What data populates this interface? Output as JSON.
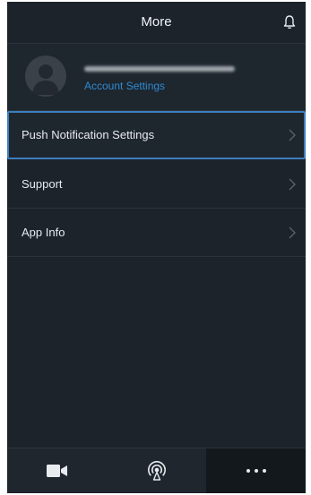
{
  "header": {
    "title": "More",
    "icon": "bell-icon"
  },
  "account": {
    "avatar_icon": "user-avatar-icon",
    "link_label": "Account Settings"
  },
  "menu": {
    "items": [
      {
        "label": "Push Notification Settings",
        "icon": "chevron-right-icon",
        "highlighted": true
      },
      {
        "label": "Support",
        "icon": "chevron-right-icon"
      },
      {
        "label": "App Info",
        "icon": "chevron-right-icon"
      }
    ]
  },
  "tabbar": {
    "tabs": [
      {
        "icon": "video-camera-icon"
      },
      {
        "icon": "broadcast-icon"
      },
      {
        "icon": "more-dots-icon",
        "active": true
      }
    ]
  },
  "colors": {
    "background": "#1c232b",
    "accent": "#2f8bd1",
    "highlight_border": "#3d7fbe"
  }
}
